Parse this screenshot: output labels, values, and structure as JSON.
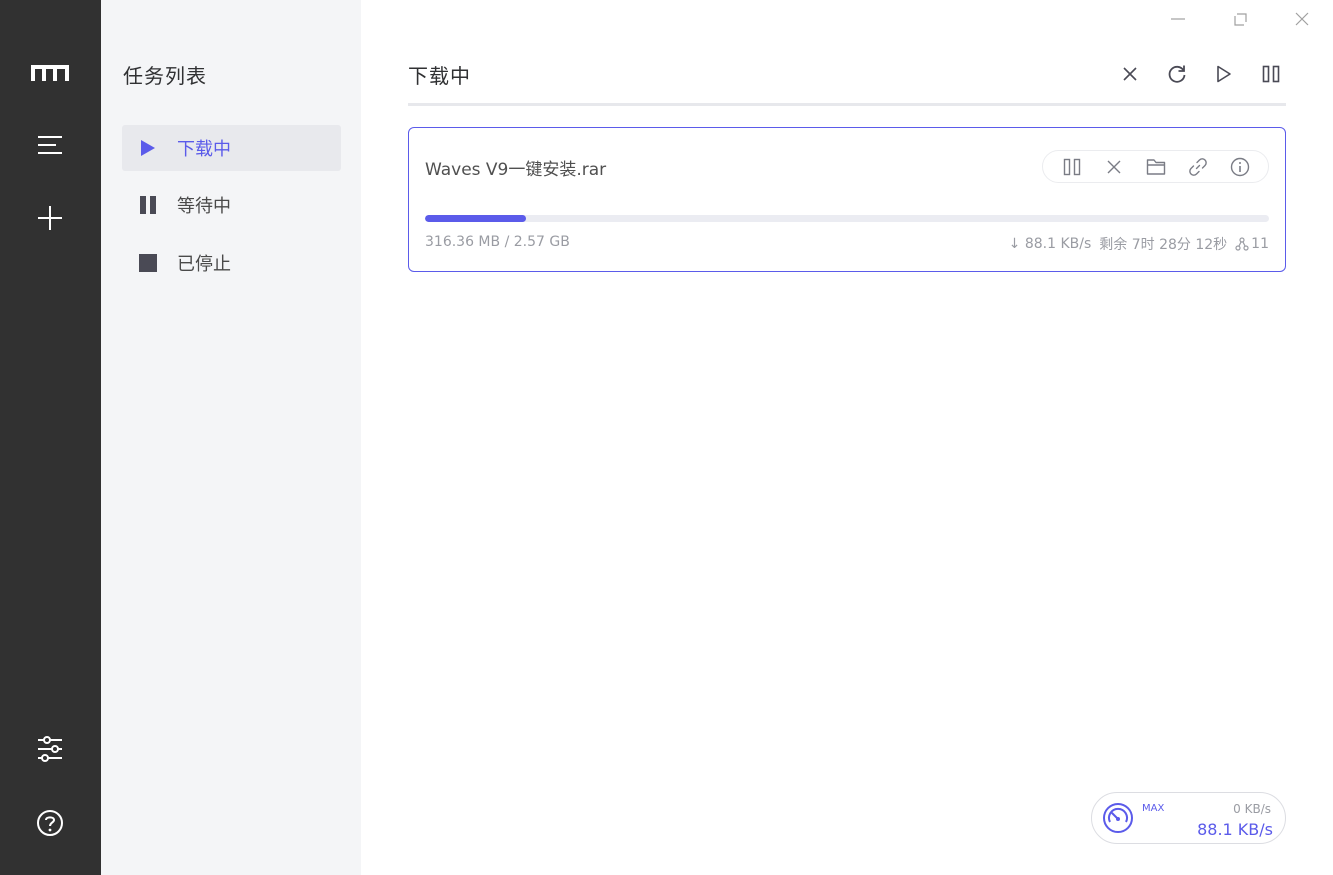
{
  "app": {
    "logo_icon": "motrix-logo-icon",
    "accent_color": "#5b5bea",
    "rail": {
      "menu_icon": "menu-icon",
      "add_icon": "add-icon",
      "settings_icon": "sliders-icon",
      "help_icon": "help-icon"
    }
  },
  "sidebar": {
    "title": "任务列表",
    "items": [
      {
        "label": "下载中",
        "icon": "play-icon",
        "active": true
      },
      {
        "label": "等待中",
        "icon": "pause-icon",
        "active": false
      },
      {
        "label": "已停止",
        "icon": "stop-icon",
        "active": false
      }
    ]
  },
  "window": {
    "minimize_icon": "minimize-icon",
    "maximize_icon": "maximize-icon",
    "close_icon": "close-icon"
  },
  "main": {
    "title": "下载中",
    "toolbar": [
      "close-icon",
      "refresh-icon",
      "play-icon",
      "pause-icon"
    ]
  },
  "task": {
    "name": "Waves V9一键安装.rar",
    "size_text": "316.36 MB / 2.57 GB",
    "progress": 0.12,
    "speed_text": "↓ 88.1 KB/s",
    "remaining_text": "剩余 7时 28分 12秒",
    "connections_text": "11",
    "actions": [
      "pause-icon",
      "delete-icon",
      "folder-icon",
      "link-icon",
      "info-icon"
    ]
  },
  "speedometer": {
    "max_label": "MAX",
    "upload": "0 KB/s",
    "download": "88.1 KB/s"
  }
}
